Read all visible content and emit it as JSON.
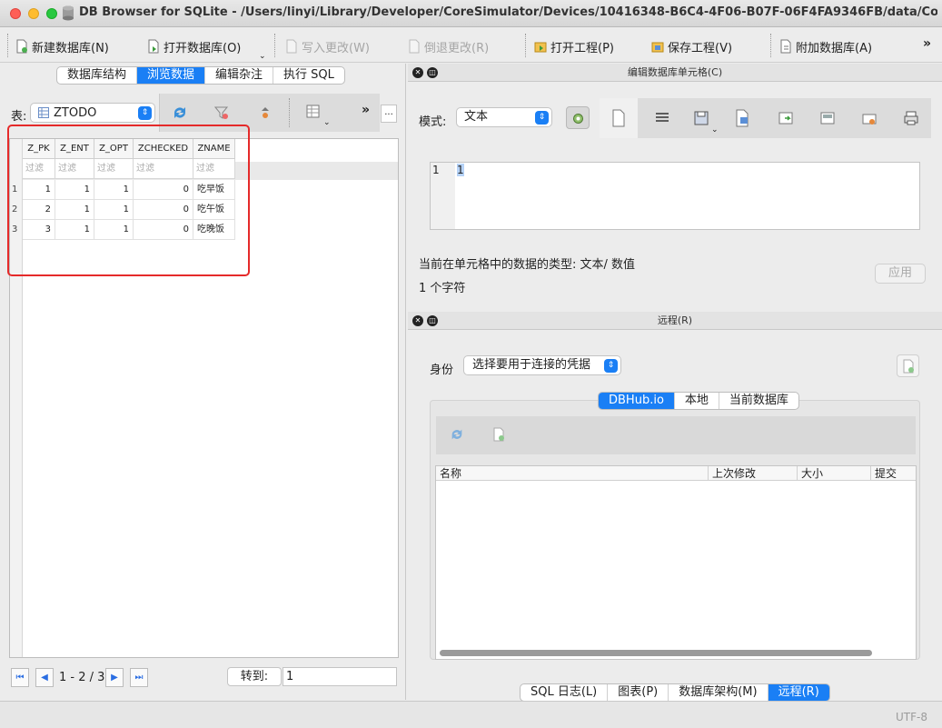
{
  "window": {
    "title": "DB Browser for SQLite - /Users/linyi/Library/Developer/CoreSimulator/Devices/10416348-B6C4-4F06-B07F-06F4FA9346FB/data/Containers/Data/..."
  },
  "toolbar": {
    "new_db": "新建数据库(N)",
    "open_db": "打开数据库(O)",
    "write_changes": "写入更改(W)",
    "revert_changes": "倒退更改(R)",
    "open_project": "打开工程(P)",
    "save_project": "保存工程(V)",
    "attach_db": "附加数据库(A)",
    "more": "»"
  },
  "left_tabs": [
    {
      "label": "数据库结构"
    },
    {
      "label": "浏览数据"
    },
    {
      "label": "编辑杂注"
    },
    {
      "label": "执行 SQL"
    }
  ],
  "browse": {
    "table_label": "表:",
    "table_name": "ZTODO",
    "more": "»",
    "ellipsis": "...",
    "columns": [
      "Z_PK",
      "Z_ENT",
      "Z_OPT",
      "ZCHECKED",
      "ZNAME"
    ],
    "filter_placeholder": "过滤",
    "rows": [
      {
        "num": "1",
        "cells": [
          "1",
          "1",
          "1",
          "0",
          "吃早饭"
        ]
      },
      {
        "num": "2",
        "cells": [
          "2",
          "1",
          "1",
          "0",
          "吃午饭"
        ]
      },
      {
        "num": "3",
        "cells": [
          "3",
          "1",
          "1",
          "0",
          "吃晚饭"
        ]
      }
    ],
    "record_count": "1 - 2 / 3",
    "goto_label": "转到:",
    "goto_value": "1"
  },
  "edit_cell": {
    "title": "编辑数据库单元格(C)",
    "mode_label": "模式:",
    "mode_value": "文本",
    "line_number": "1",
    "content": "1",
    "type_info": "当前在单元格中的数据的类型: 文本/ 数值",
    "char_count": "1 个字符",
    "apply_label": "应用"
  },
  "remote": {
    "title": "远程(R)",
    "identity_label": "身份",
    "identity_value": "选择要用于连接的凭据",
    "tabs": [
      {
        "label": "DBHub.io"
      },
      {
        "label": "本地"
      },
      {
        "label": "当前数据库"
      }
    ],
    "columns": [
      "名称",
      "上次修改",
      "大小",
      "提交"
    ]
  },
  "bottom_tabs": [
    {
      "label": "SQL 日志(L)"
    },
    {
      "label": "图表(P)"
    },
    {
      "label": "数据库架构(M)"
    },
    {
      "label": "远程(R)"
    }
  ],
  "status": {
    "encoding": "UTF-8"
  },
  "colors": {
    "accent": "#1a7ff5",
    "highlight_box": "#e52a2a"
  }
}
